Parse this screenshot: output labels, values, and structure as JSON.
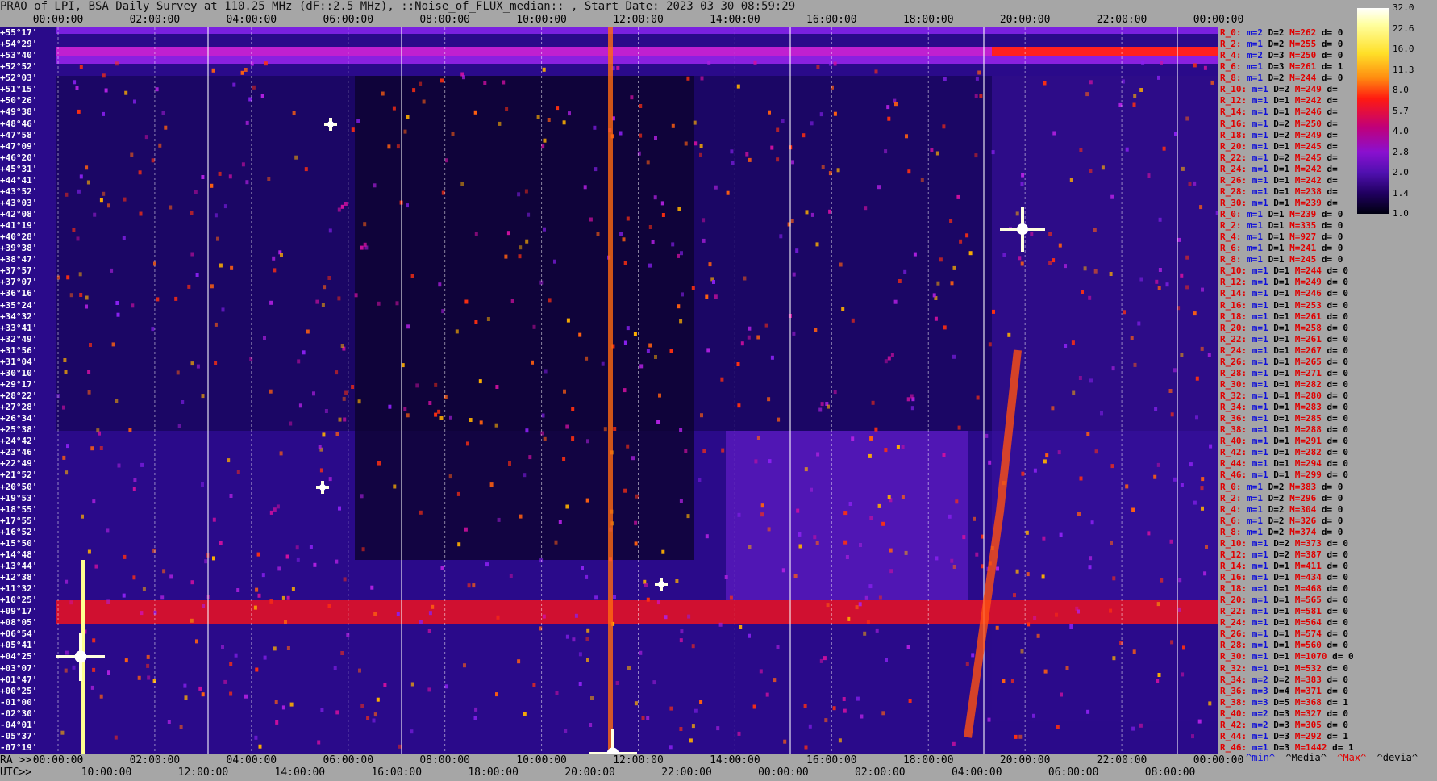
{
  "title": "PRAO of LPI, BSA Daily Survey at 110.25 MHz (dF::2.5 MHz), ::Noise_of_FLUX_median:: , Start Date: 2023 03 30 08:59:29",
  "top_axis": [
    "00:00:00",
    "02:00:00",
    "04:00:00",
    "06:00:00",
    "08:00:00",
    "10:00:00",
    "12:00:00",
    "14:00:00",
    "16:00:00",
    "18:00:00",
    "20:00:00",
    "22:00:00",
    "00:00:00"
  ],
  "ra_axis": {
    "prefix": "RA >>",
    "ticks": [
      "00:00:00",
      "02:00:00",
      "04:00:00",
      "06:00:00",
      "08:00:00",
      "10:00:00",
      "12:00:00",
      "14:00:00",
      "16:00:00",
      "18:00:00",
      "20:00:00",
      "22:00:00",
      "00:00:00"
    ]
  },
  "utc_axis": {
    "prefix": "UTC>>",
    "ticks": [
      "10:00:00",
      "12:00:00",
      "14:00:00",
      "16:00:00",
      "18:00:00",
      "20:00:00",
      "22:00:00",
      "00:00:00",
      "02:00:00",
      "04:00:00",
      "06:00:00",
      "08:00:00"
    ]
  },
  "declinations": [
    "+55°17'",
    "+54°29'",
    "+53°40'",
    "+52°52'",
    "+52°03'",
    "+51°15'",
    "+50°26'",
    "+49°38'",
    "+48°46'",
    "+47°58'",
    "+47°09'",
    "+46°20'",
    "+45°31'",
    "+44°41'",
    "+43°52'",
    "+43°03'",
    "+42°08'",
    "+41°19'",
    "+40°28'",
    "+39°38'",
    "+38°47'",
    "+37°57'",
    "+37°07'",
    "+36°16'",
    "+35°24'",
    "+34°32'",
    "+33°41'",
    "+32°49'",
    "+31°56'",
    "+31°04'",
    "+30°10'",
    "+29°17'",
    "+28°22'",
    "+27°28'",
    "+26°34'",
    "+25°38'",
    "+24°42'",
    "+23°46'",
    "+22°49'",
    "+21°52'",
    "+20°50'",
    "+19°53'",
    "+18°55'",
    "+17°55'",
    "+16°52'",
    "+15°50'",
    "+14°48'",
    "+13°44'",
    "+12°38'",
    "+11°32'",
    "+10°25'",
    "+09°17'",
    "+08°05'",
    "+06°54'",
    "+05°41'",
    "+04°25'",
    "+03°07'",
    "+01°47'",
    "+00°25'",
    "-01°00'",
    "-02°30'",
    "-04°01'",
    "-05°37'",
    "-07°19'"
  ],
  "stats": [
    {
      "r": "R_0:",
      "m": "m=2",
      "d": "D=2",
      "x": "M=262",
      "dev": "d= 0"
    },
    {
      "r": "R_2:",
      "m": "m=1",
      "d": "D=2",
      "x": "M=255",
      "dev": "d= 0"
    },
    {
      "r": "R_4:",
      "m": "m=2",
      "d": "D=3",
      "x": "M=250",
      "dev": "d= 0"
    },
    {
      "r": "R_6:",
      "m": "m=1",
      "d": "D=3",
      "x": "M=261",
      "dev": "d= 1"
    },
    {
      "r": "R_8:",
      "m": "m=1",
      "d": "D=2",
      "x": "M=244",
      "dev": "d= 0"
    },
    {
      "r": "R_10:",
      "m": "m=1",
      "d": "D=2",
      "x": "M=249",
      "dev": "d="
    },
    {
      "r": "R_12:",
      "m": "m=1",
      "d": "D=1",
      "x": "M=242",
      "dev": "d="
    },
    {
      "r": "R_14:",
      "m": "m=1",
      "d": "D=1",
      "x": "M=246",
      "dev": "d="
    },
    {
      "r": "R_16:",
      "m": "m=1",
      "d": "D=2",
      "x": "M=250",
      "dev": "d="
    },
    {
      "r": "R_18:",
      "m": "m=1",
      "d": "D=2",
      "x": "M=249",
      "dev": "d="
    },
    {
      "r": "R_20:",
      "m": "m=1",
      "d": "D=1",
      "x": "M=245",
      "dev": "d="
    },
    {
      "r": "R_22:",
      "m": "m=1",
      "d": "D=2",
      "x": "M=245",
      "dev": "d="
    },
    {
      "r": "R_24:",
      "m": "m=1",
      "d": "D=1",
      "x": "M=242",
      "dev": "d="
    },
    {
      "r": "R_26:",
      "m": "m=1",
      "d": "D=1",
      "x": "M=242",
      "dev": "d="
    },
    {
      "r": "R_28:",
      "m": "m=1",
      "d": "D=1",
      "x": "M=238",
      "dev": "d="
    },
    {
      "r": "R_30:",
      "m": "m=1",
      "d": "D=1",
      "x": "M=239",
      "dev": "d="
    },
    {
      "r": "R_0:",
      "m": "m=1",
      "d": "D=1",
      "x": "M=239",
      "dev": "d= 0"
    },
    {
      "r": "R_2:",
      "m": "m=1",
      "d": "D=1",
      "x": "M=335",
      "dev": "d= 0"
    },
    {
      "r": "R_4:",
      "m": "m=1",
      "d": "D=1",
      "x": "M=927",
      "dev": "d= 0"
    },
    {
      "r": "R_6:",
      "m": "m=1",
      "d": "D=1",
      "x": "M=241",
      "dev": "d= 0"
    },
    {
      "r": "R_8:",
      "m": "m=1",
      "d": "D=1",
      "x": "M=245",
      "dev": "d= 0"
    },
    {
      "r": "R_10:",
      "m": "m=1",
      "d": "D=1",
      "x": "M=244",
      "dev": "d= 0"
    },
    {
      "r": "R_12:",
      "m": "m=1",
      "d": "D=1",
      "x": "M=249",
      "dev": "d= 0"
    },
    {
      "r": "R_14:",
      "m": "m=1",
      "d": "D=1",
      "x": "M=246",
      "dev": "d= 0"
    },
    {
      "r": "R_16:",
      "m": "m=1",
      "d": "D=1",
      "x": "M=253",
      "dev": "d= 0"
    },
    {
      "r": "R_18:",
      "m": "m=1",
      "d": "D=1",
      "x": "M=261",
      "dev": "d= 0"
    },
    {
      "r": "R_20:",
      "m": "m=1",
      "d": "D=1",
      "x": "M=258",
      "dev": "d= 0"
    },
    {
      "r": "R_22:",
      "m": "m=1",
      "d": "D=1",
      "x": "M=261",
      "dev": "d= 0"
    },
    {
      "r": "R_24:",
      "m": "m=1",
      "d": "D=1",
      "x": "M=267",
      "dev": "d= 0"
    },
    {
      "r": "R_26:",
      "m": "m=1",
      "d": "D=1",
      "x": "M=265",
      "dev": "d= 0"
    },
    {
      "r": "R_28:",
      "m": "m=1",
      "d": "D=1",
      "x": "M=271",
      "dev": "d= 0"
    },
    {
      "r": "R_30:",
      "m": "m=1",
      "d": "D=1",
      "x": "M=282",
      "dev": "d= 0"
    },
    {
      "r": "R_32:",
      "m": "m=1",
      "d": "D=1",
      "x": "M=280",
      "dev": "d= 0"
    },
    {
      "r": "R_34:",
      "m": "m=1",
      "d": "D=1",
      "x": "M=283",
      "dev": "d= 0"
    },
    {
      "r": "R_36:",
      "m": "m=1",
      "d": "D=1",
      "x": "M=285",
      "dev": "d= 0"
    },
    {
      "r": "R_38:",
      "m": "m=1",
      "d": "D=1",
      "x": "M=288",
      "dev": "d= 0"
    },
    {
      "r": "R_40:",
      "m": "m=1",
      "d": "D=1",
      "x": "M=291",
      "dev": "d= 0"
    },
    {
      "r": "R_42:",
      "m": "m=1",
      "d": "D=1",
      "x": "M=282",
      "dev": "d= 0"
    },
    {
      "r": "R_44:",
      "m": "m=1",
      "d": "D=1",
      "x": "M=294",
      "dev": "d= 0"
    },
    {
      "r": "R_46:",
      "m": "m=1",
      "d": "D=1",
      "x": "M=299",
      "dev": "d= 0"
    },
    {
      "r": "R_0:",
      "m": "m=1",
      "d": "D=2",
      "x": "M=383",
      "dev": "d= 0"
    },
    {
      "r": "R_2:",
      "m": "m=1",
      "d": "D=2",
      "x": "M=296",
      "dev": "d= 0"
    },
    {
      "r": "R_4:",
      "m": "m=1",
      "d": "D=2",
      "x": "M=304",
      "dev": "d= 0"
    },
    {
      "r": "R_6:",
      "m": "m=1",
      "d": "D=2",
      "x": "M=326",
      "dev": "d= 0"
    },
    {
      "r": "R_8:",
      "m": "m=1",
      "d": "D=2",
      "x": "M=374",
      "dev": "d= 0"
    },
    {
      "r": "R_10:",
      "m": "m=1",
      "d": "D=2",
      "x": "M=373",
      "dev": "d= 0"
    },
    {
      "r": "R_12:",
      "m": "m=1",
      "d": "D=2",
      "x": "M=387",
      "dev": "d= 0"
    },
    {
      "r": "R_14:",
      "m": "m=1",
      "d": "D=1",
      "x": "M=411",
      "dev": "d= 0"
    },
    {
      "r": "R_16:",
      "m": "m=1",
      "d": "D=1",
      "x": "M=434",
      "dev": "d= 0"
    },
    {
      "r": "R_18:",
      "m": "m=1",
      "d": "D=1",
      "x": "M=468",
      "dev": "d= 0"
    },
    {
      "r": "R_20:",
      "m": "m=1",
      "d": "D=1",
      "x": "M=565",
      "dev": "d= 0"
    },
    {
      "r": "R_22:",
      "m": "m=1",
      "d": "D=1",
      "x": "M=581",
      "dev": "d= 0"
    },
    {
      "r": "R_24:",
      "m": "m=1",
      "d": "D=1",
      "x": "M=564",
      "dev": "d= 0"
    },
    {
      "r": "R_26:",
      "m": "m=1",
      "d": "D=1",
      "x": "M=574",
      "dev": "d= 0"
    },
    {
      "r": "R_28:",
      "m": "m=1",
      "d": "D=1",
      "x": "M=560",
      "dev": "d= 0"
    },
    {
      "r": "R_30:",
      "m": "m=1",
      "d": "D=1",
      "x": "M=1070",
      "dev": "d= 0"
    },
    {
      "r": "R_32:",
      "m": "m=1",
      "d": "D=1",
      "x": "M=532",
      "dev": "d= 0"
    },
    {
      "r": "R_34:",
      "m": "m=2",
      "d": "D=2",
      "x": "M=383",
      "dev": "d= 0"
    },
    {
      "r": "R_36:",
      "m": "m=3",
      "d": "D=4",
      "x": "M=371",
      "dev": "d= 0"
    },
    {
      "r": "R_38:",
      "m": "m=3",
      "d": "D=5",
      "x": "M=368",
      "dev": "d= 1"
    },
    {
      "r": "R_40:",
      "m": "m=2",
      "d": "D=3",
      "x": "M=327",
      "dev": "d= 0"
    },
    {
      "r": "R_42:",
      "m": "m=2",
      "d": "D=3",
      "x": "M=305",
      "dev": "d= 0"
    },
    {
      "r": "R_44:",
      "m": "m=1",
      "d": "D=3",
      "x": "M=292",
      "dev": "d= 1"
    },
    {
      "r": "R_46:",
      "m": "m=1",
      "d": "D=3",
      "x": "M=1442",
      "dev": "d= 1"
    }
  ],
  "legend": {
    "min": "^min^",
    "median": "^Media^",
    "max": "^Max^",
    "dev": "^devia^"
  },
  "colorbar": {
    "ticks": [
      "32.0",
      "22.6",
      "16.0",
      "11.3",
      "8.0",
      "5.7",
      "4.0",
      "2.8",
      "2.0",
      "1.4",
      "1.0"
    ],
    "scale": "log2"
  },
  "colors": {
    "background": "#a6a6a6",
    "label_red": "#e00000",
    "label_blue": "#1010d8"
  }
}
